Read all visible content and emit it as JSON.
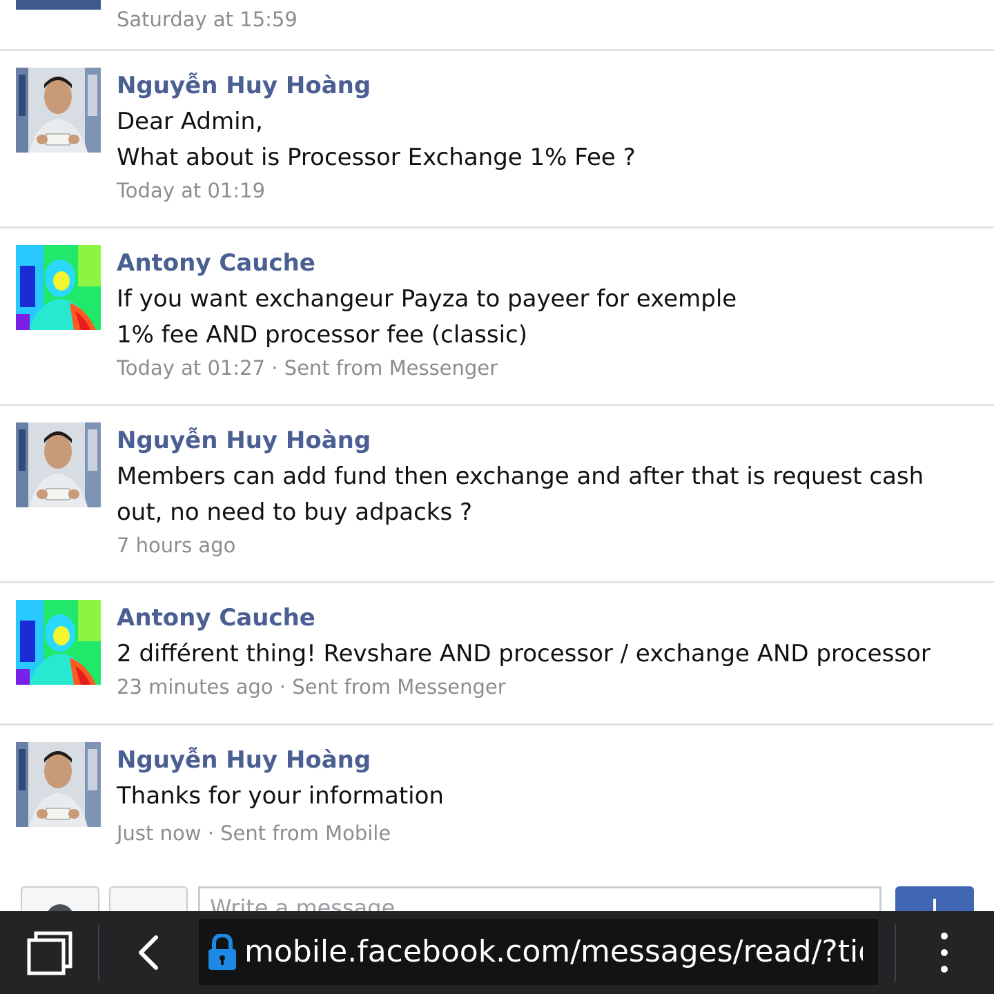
{
  "thread": {
    "top_partial_timestamp": "Saturday at 15:59",
    "messages": [
      {
        "sender": "Nguyễn Huy Hoàng",
        "body": "Dear Admin,\nWhat about is Processor Exchange 1% Fee ?",
        "meta": "Today at 01:19"
      },
      {
        "sender": "Antony Cauche",
        "body": "If you want exchangeur Payza to payeer for exemple\n1% fee AND processor fee (classic)",
        "meta": "Today at 01:27 · Sent from Messenger"
      },
      {
        "sender": "Nguyễn Huy Hoàng",
        "body": "Members can add fund then exchange and after that is request cash out, no need to buy adpacks ?",
        "meta": "7 hours ago"
      },
      {
        "sender": "Antony Cauche",
        "body": "2 différent thing! Revshare AND processor / exchange AND processor",
        "meta": "23 minutes ago · Sent from Messenger"
      },
      {
        "sender": "Nguyễn Huy Hoàng",
        "body": "Thanks for your information",
        "meta": "Just now · Sent from Mobile"
      }
    ]
  },
  "composer": {
    "placeholder": "Write a message..."
  },
  "browser": {
    "url": "mobile.facebook.com/messages/read/?tid=",
    "icons": [
      "tabs-icon",
      "back-arrow-icon",
      "lock-icon",
      "more-vertical-icon"
    ]
  },
  "colors": {
    "sender_name": "#4b5f93",
    "meta_text": "#8a8d91",
    "divider": "#e2e3e6",
    "browser_bar": "#222426",
    "send_button": "#4267b2"
  }
}
